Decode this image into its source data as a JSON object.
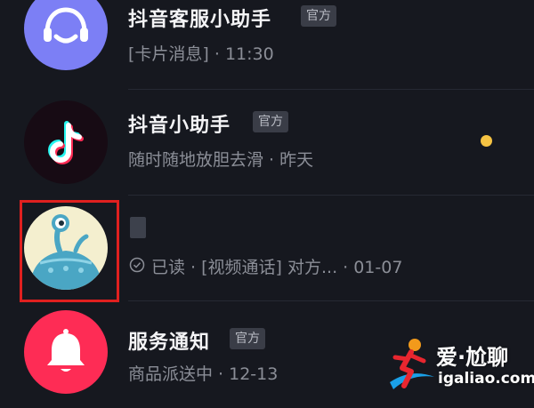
{
  "conversations": [
    {
      "title": "抖音客服小助手",
      "badge": "官方",
      "subtitle": "[卡片消息] · 11:30",
      "avatar_icon": "headset-smile-icon",
      "avatar_color": "#7c7ff5"
    },
    {
      "title": "抖音小助手",
      "badge": "官方",
      "subtitle": "随时随地放胆去滑 · 昨天",
      "avatar_icon": "tiktok-logo-icon",
      "avatar_color": "#170b14",
      "unread": true,
      "unread_color": "#f6c343"
    },
    {
      "title": "",
      "status_icon": "read-check-icon",
      "subtitle": "已读 · [视频通话] 对方... · 01-07",
      "avatar_icon": "alien-creature-icon",
      "avatar_color": "#f4efcf",
      "highlighted": true,
      "highlight_color": "#e0201f"
    },
    {
      "title": "服务通知",
      "badge": "官方",
      "subtitle": "商品派送中 · 12-13",
      "avatar_icon": "bell-icon",
      "avatar_color": "#fe2c55"
    }
  ],
  "watermark": {
    "brand": "爱·尬聊",
    "url": "igaliao.com"
  }
}
